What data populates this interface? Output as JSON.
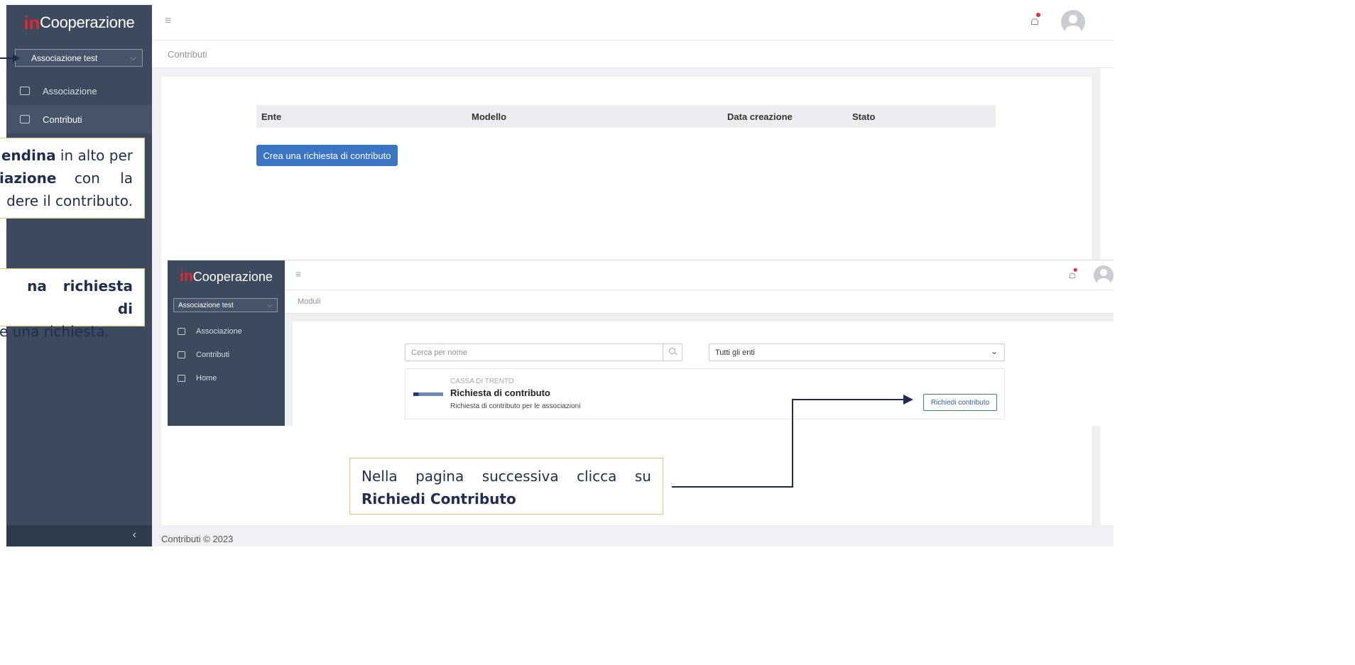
{
  "brand": {
    "prefix": "in",
    "name": "Cooperazione"
  },
  "sidebar": {
    "association_select": "Associazione test",
    "items": [
      {
        "label": "Associazione",
        "icon": "square-icon"
      },
      {
        "label": "Contributi",
        "icon": "folder-icon",
        "active": true
      }
    ],
    "collapse_glyph": "‹"
  },
  "topbar": {
    "menu_glyph": "≡"
  },
  "breadcrumb": "Contributi",
  "table": {
    "columns": [
      "Ente",
      "Modello",
      "Data creazione",
      "Stato"
    ]
  },
  "create_button": "Crea una richiesta di contributo",
  "footer": "Contributi © 2023",
  "callouts": {
    "first": {
      "l1a": "endina",
      "l1b": " in alto per",
      "l2a": "iazione",
      "l2b": "con la",
      "l3": "dere il contributo."
    },
    "second": {
      "l1a": "na richiesta di",
      "l2": "e una richiesta."
    },
    "third": {
      "text": "Nella pagina successiva clicca su",
      "bold": "Richiedi Contributo"
    }
  },
  "inset": {
    "association_select": "Associazione test",
    "nav": [
      {
        "label": "Associazione",
        "icon": "square-icon"
      },
      {
        "label": "Contributi",
        "icon": "folder-icon"
      },
      {
        "label": "Home",
        "icon": "home-icon"
      }
    ],
    "breadcrumb": "Moduli",
    "search_placeholder": "Cerca per nome",
    "ente_filter": "Tutti gli enti",
    "module": {
      "ente": "CASSA DI TRENTO",
      "title": "Richiesta di contributo",
      "description": "Richiesta di contributo per le associazioni",
      "button": "Richiedi contributo"
    }
  },
  "colors": {
    "sidebar": "#3c4a5e",
    "accent": "#3a75c4",
    "brand_red": "#e3262f",
    "callout_border": "#f1c06b"
  }
}
